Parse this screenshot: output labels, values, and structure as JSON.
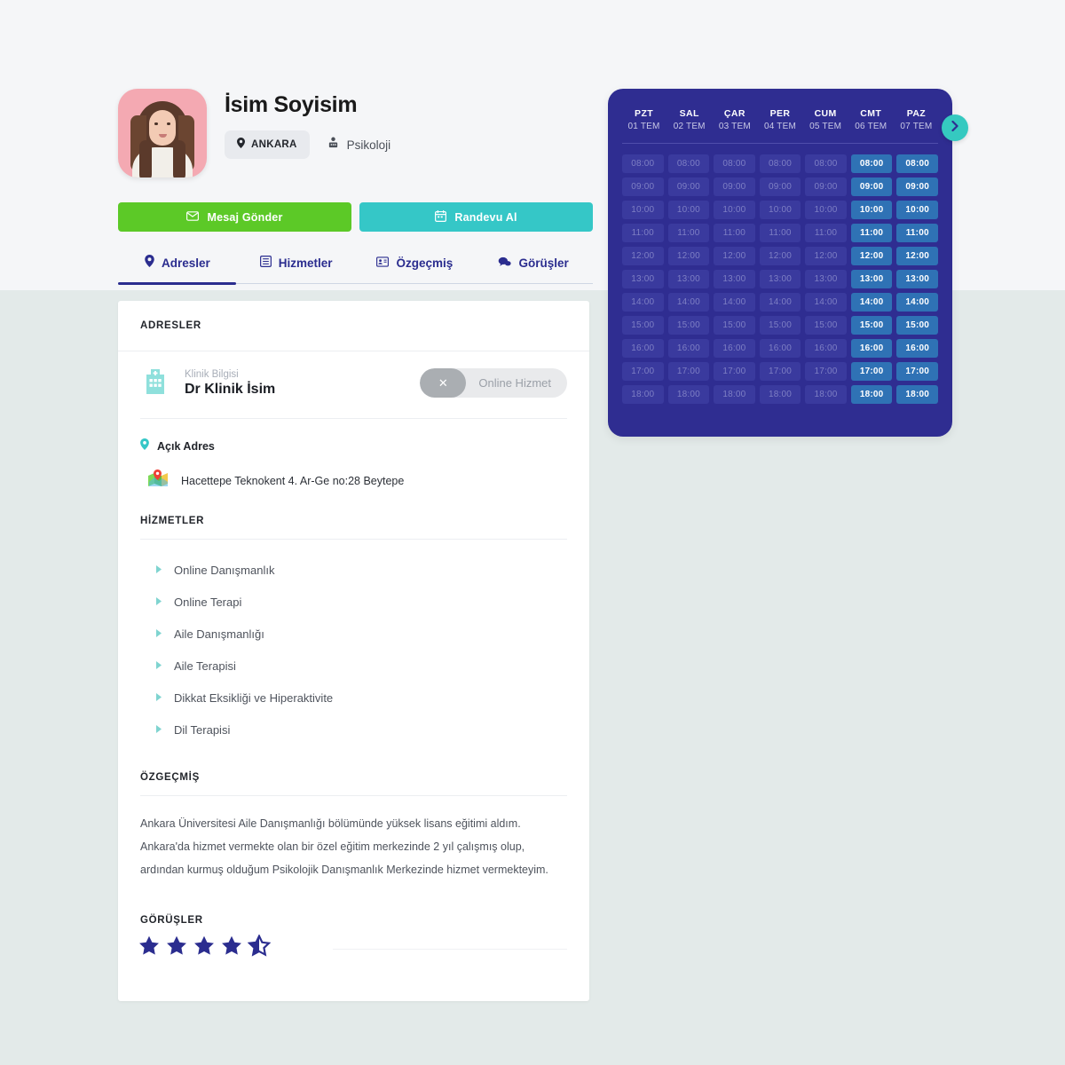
{
  "profile": {
    "name": "İsim Soyisim",
    "location_chip": "ANKARA",
    "specialty": "Psikoloji",
    "avatar_alt": "profile-photo"
  },
  "actions": {
    "message_label": "Mesaj Gönder",
    "appointment_label": "Randevu Al"
  },
  "tabs": [
    {
      "label": "Adresler",
      "icon": "location-pin-icon",
      "active": true
    },
    {
      "label": "Hizmetler",
      "icon": "list-icon",
      "active": false
    },
    {
      "label": "Özgeçmiş",
      "icon": "id-card-icon",
      "active": false
    },
    {
      "label": "Görüşler",
      "icon": "chat-bubble-icon",
      "active": false
    }
  ],
  "addresses": {
    "section_title": "ADRESLER",
    "clinic_sub": "Klinik Bilgisi",
    "clinic_name": "Dr Klinik İsim",
    "online_toggle": {
      "state_icon": "close-x-icon",
      "label": "Online Hizmet",
      "enabled": false
    },
    "open_address_title": "Açık Adres",
    "address_text": "Hacettepe Teknokent 4. Ar-Ge no:28 Beytepe"
  },
  "services": {
    "section_title": "HİZMETLER",
    "items": [
      "Online Danışmanlık",
      "Online Terapi",
      "Aile Danışmanlığı",
      "Aile Terapisi",
      "Dikkat Eksikliği ve Hiperaktivite",
      "Dil Terapisi"
    ]
  },
  "cv": {
    "section_title": "ÖZGEÇMİŞ",
    "lines": [
      "Ankara Üniversitesi Aile Danışmanlığı bölümünde yüksek lisans eğitimi aldım.",
      "Ankara'da hizmet vermekte olan bir özel eğitim merkezinde 2 yıl çalışmış olup,",
      "ardından kurmuş olduğum Psikolojik Danışmanlık Merkezinde hizmet vermekteyim."
    ]
  },
  "reviews": {
    "section_title": "GÖRÜŞLER",
    "rating": 4.5,
    "max_rating": 5
  },
  "calendar": {
    "next_icon": "chevron-right-icon",
    "days": [
      {
        "name": "PZT",
        "date": "01 TEM",
        "available": false
      },
      {
        "name": "SAL",
        "date": "02 TEM",
        "available": false
      },
      {
        "name": "ÇAR",
        "date": "03 TEM",
        "available": false
      },
      {
        "name": "PER",
        "date": "04 TEM",
        "available": false
      },
      {
        "name": "CUM",
        "date": "05 TEM",
        "available": false
      },
      {
        "name": "CMT",
        "date": "06 TEM",
        "available": true
      },
      {
        "name": "PAZ",
        "date": "07 TEM",
        "available": true
      }
    ],
    "times": [
      "08:00",
      "09:00",
      "10:00",
      "11:00",
      "12:00",
      "13:00",
      "14:00",
      "15:00",
      "16:00",
      "17:00",
      "18:00"
    ]
  },
  "colors": {
    "brand_navy": "#2f2d91",
    "accent_teal": "#35c7c7",
    "accent_green": "#5cc927",
    "slot_active": "#2f72b5",
    "slot_inactive": "#3a3a9e",
    "page_bg_top": "#f5f6f8",
    "page_bg_bottom": "#e3eae9"
  }
}
